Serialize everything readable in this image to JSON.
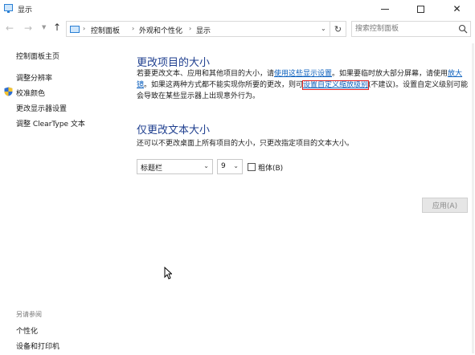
{
  "window": {
    "title": "显示"
  },
  "nav": {
    "breadcrumbs": [
      "控制面板",
      "外观和个性化",
      "显示"
    ],
    "search_placeholder": "搜索控制面板"
  },
  "sidebar": {
    "home": "控制面板主页",
    "links": [
      "调整分辨率",
      "校准颜色",
      "更改显示器设置",
      "调整 ClearType 文本"
    ],
    "see_also_heading": "另请参阅",
    "see_also": [
      "个性化",
      "设备和打印机"
    ]
  },
  "main": {
    "section1_title": "更改项目的大小",
    "p1_line1_a": "若要更改文本、应用和其他项目的大小，请",
    "p1_line1_link": "使用这些显示设置",
    "p1_line1_b": "。如果要临时放大部分屏幕，请使用",
    "p1_line1_link2": "放大",
    "p1_line2_link": "镜",
    "p1_line2_a": "。如果这两种方式都不能实现你所要的更改，则可",
    "p1_line2_link2": "设置自定义缩放级别",
    "p1_line2_b": "(不建议)。设置自定义级别可能",
    "p1_line3": "会导致在某些显示器上出现意外行为。",
    "section2_title": "仅更改文本大小",
    "p2": "还可以不更改桌面上所有项目的大小，只更改指定项目的文本大小。",
    "item_select": "标题栏",
    "size_select": "9",
    "bold_label": "粗体(B)",
    "apply_label": "应用(A)"
  },
  "colors": {
    "heading": "#1f3f8f",
    "link": "#0b5fbd",
    "highlight_box": "#e02020"
  }
}
